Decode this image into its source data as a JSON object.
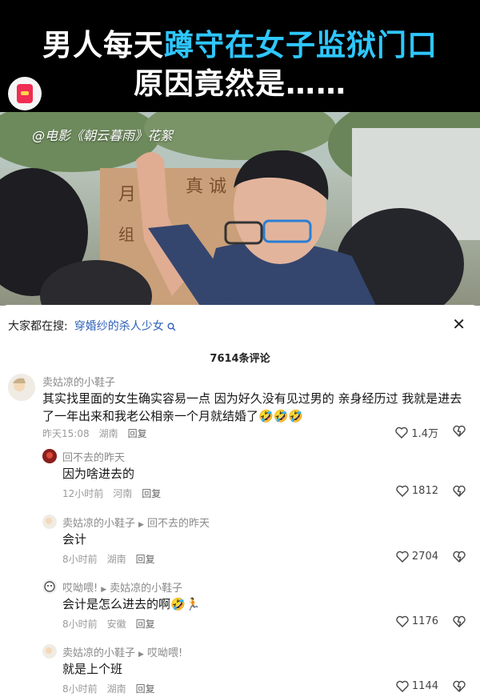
{
  "banner": {
    "title_line1_a": "男人每天",
    "title_line1_b": "蹲守在女子监狱门口",
    "title_line2": "原因竟然是……",
    "watermark": "@电影《朝云暮雨》花絮",
    "accent_color": "#2ec7ff"
  },
  "search": {
    "prefix": "大家都在搜:",
    "keyword": "穿婚纱的杀人少女",
    "icon": "search-icon"
  },
  "comment_count": "7614条评论",
  "comments": [
    {
      "user": "卖姑凉的小鞋子",
      "reply_to": "",
      "text": "其实找里面的女生确实容易一点 因为好久没有见过男的 亲身经历过 我就是进去了一年出来和我老公相亲一个月就结婚了🤣🤣🤣",
      "time": "昨天15:08",
      "location": "湖南",
      "reply": "回复",
      "likes": "1.4万"
    },
    {
      "user": "回不去的昨天",
      "reply_to": "",
      "text": "因为啥进去的",
      "time": "12小时前",
      "location": "河南",
      "reply": "回复",
      "likes": "1812"
    },
    {
      "user": "卖姑凉的小鞋子",
      "reply_to": "回不去的昨天",
      "text": "会计",
      "time": "8小时前",
      "location": "湖南",
      "reply": "回复",
      "likes": "2704"
    },
    {
      "user": "哎呦喂!",
      "reply_to": "卖姑凉的小鞋子",
      "text": "会计是怎么进去的啊🤣🏃",
      "time": "8小时前",
      "location": "安徽",
      "reply": "回复",
      "likes": "1176"
    },
    {
      "user": "卖姑凉的小鞋子",
      "reply_to": "哎呦喂!",
      "text": "就是上个班",
      "time": "8小时前",
      "location": "湖南",
      "reply": "回复",
      "likes": "1144"
    }
  ]
}
